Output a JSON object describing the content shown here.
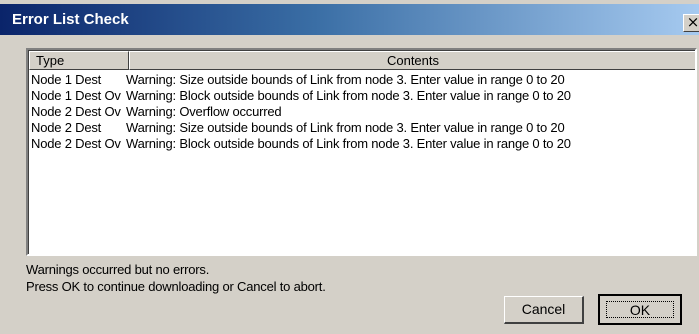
{
  "window": {
    "title": "Error List Check",
    "close_label": "×"
  },
  "list": {
    "columns": [
      "Type",
      "Contents"
    ],
    "rows": [
      {
        "type": "Node 1 Dest",
        "contents": "Warning: Size outside bounds of Link from node 3. Enter value in  range 0 to 20"
      },
      {
        "type": "Node 1 Dest Ov",
        "contents": "Warning: Block outside bounds of Link from node 3. Enter value in  range 0 to 20"
      },
      {
        "type": "Node 2 Dest Ov",
        "contents": "Warning: Overflow occurred"
      },
      {
        "type": "Node 2 Dest",
        "contents": "Warning: Size outside bounds of Link from node 3. Enter value in  range 0 to 20"
      },
      {
        "type": "Node 2 Dest Ov",
        "contents": "Warning: Block outside bounds of Link from node 3. Enter value in  range 0 to 20"
      }
    ]
  },
  "status": {
    "line1": "Warnings occurred but no errors.",
    "line2": "Press OK to continue downloading or Cancel to abort."
  },
  "buttons": {
    "cancel": "Cancel",
    "ok": "OK"
  }
}
